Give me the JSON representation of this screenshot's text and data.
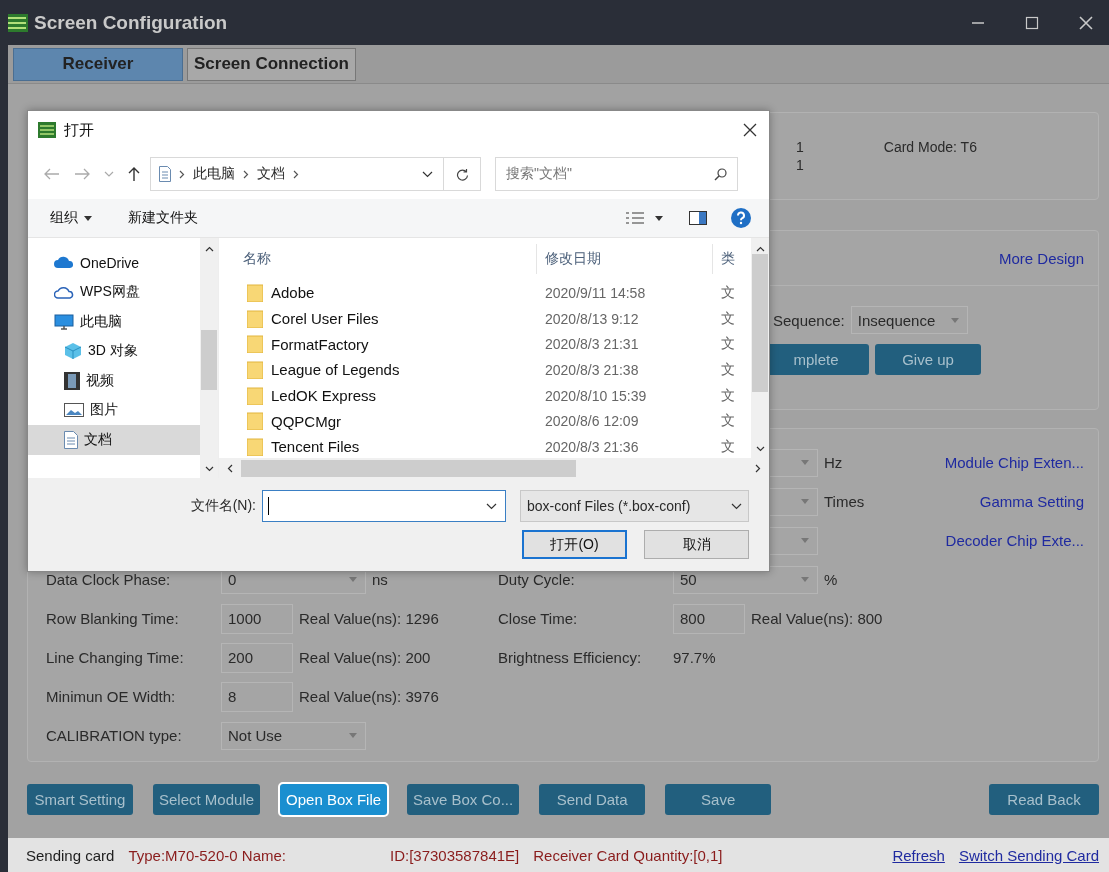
{
  "window": {
    "title": "Screen Configuration"
  },
  "tabs": [
    {
      "label": "Receiver",
      "selected": true
    },
    {
      "label": "Screen Connection",
      "selected": false
    }
  ],
  "card_info": {
    "values": [
      "1",
      "1"
    ],
    "card_mode": "Card Mode:  T6"
  },
  "design": {
    "link": "More Design",
    "sequence_label": "Sequence:",
    "sequence_value": "Insequence",
    "buttons": [
      "mplete",
      "Give up"
    ]
  },
  "parameters": {
    "side_rows": [
      {
        "unit": "Hz",
        "link": "Module Chip Exten..."
      },
      {
        "unit": "Times",
        "link": "Gamma Setting"
      },
      {
        "link": "Decoder Chip Exte..."
      }
    ],
    "rows": [
      {
        "left": {
          "label": "Data Clock Phase:",
          "kind": "dropdown",
          "value": "0",
          "unit": "ns"
        },
        "right": {
          "label": "Duty Cycle:",
          "kind": "dropdown",
          "value": "50",
          "unit": "%"
        }
      },
      {
        "left": {
          "label": "Row Blanking Time:",
          "kind": "input",
          "value": "1000",
          "unit": "Real Value(ns): 1296"
        },
        "right": {
          "label": "Close Time:",
          "kind": "input",
          "value": "800",
          "unit": "Real Value(ns): 800"
        }
      },
      {
        "left": {
          "label": "Line Changing Time:",
          "kind": "input",
          "value": "200",
          "unit": "Real Value(ns): 200"
        },
        "right": {
          "label": "Brightness Efficiency:",
          "kind": "text",
          "value": "97.7%"
        }
      },
      {
        "left": {
          "label": "Minimun OE Width:",
          "kind": "input",
          "value": "8",
          "unit": "Real Value(ns): 3976"
        }
      },
      {
        "left": {
          "label": "CALIBRATION type:",
          "kind": "dropdown",
          "value": "Not Use"
        }
      }
    ]
  },
  "actions": [
    {
      "label": "Smart Setting",
      "focused": false
    },
    {
      "label": "Select Module",
      "focused": false
    },
    {
      "label": "Open Box File",
      "focused": true
    },
    {
      "label": "Save Box Co...",
      "focused": false
    },
    {
      "label": "Send Data",
      "focused": false
    },
    {
      "label": "Save",
      "focused": false
    }
  ],
  "right_action": "Read Back",
  "status_bar": {
    "parts": [
      {
        "text": "Sending card",
        "color": "#1e1e1e"
      },
      {
        "text": "Type:M70-520-0 Name:",
        "color": "#8a1c1c"
      },
      {
        "text": "ID:[37303587841E]",
        "color": "#8a1c1c"
      },
      {
        "text": "Receiver Card Quantity:[0,1]",
        "color": "#8a1c1c"
      }
    ],
    "links": [
      "Refresh",
      "Switch Sending Card"
    ]
  },
  "dialog": {
    "title": "打开",
    "breadcrumb": [
      "此电脑",
      "文档"
    ],
    "search_placeholder": "搜索\"文档\"",
    "toolbar": [
      "组织",
      "新建文件夹"
    ],
    "nav": [
      {
        "label": "OneDrive",
        "kind": "cloud",
        "selected": false
      },
      {
        "label": "WPS网盘",
        "kind": "cloud-outline",
        "selected": false
      },
      {
        "label": "此电脑",
        "kind": "computer",
        "selected": false,
        "children": [
          {
            "label": "3D 对象",
            "kind": "cube",
            "selected": false
          },
          {
            "label": "视频",
            "kind": "video",
            "selected": false
          },
          {
            "label": "图片",
            "kind": "picture",
            "selected": false
          },
          {
            "label": "文档",
            "kind": "document",
            "selected": true
          }
        ]
      }
    ],
    "columns": [
      "名称",
      "修改日期",
      "类"
    ],
    "files": [
      {
        "name": "Adobe",
        "date": "2020/9/11 14:58",
        "type": "文"
      },
      {
        "name": "Corel User Files",
        "date": "2020/8/13 9:12",
        "type": "文"
      },
      {
        "name": "FormatFactory",
        "date": "2020/8/3 21:31",
        "type": "文"
      },
      {
        "name": "League of Legends",
        "date": "2020/8/3 21:38",
        "type": "文"
      },
      {
        "name": "LedOK Express",
        "date": "2020/8/10 15:39",
        "type": "文"
      },
      {
        "name": "QQPCMgr",
        "date": "2020/8/6 12:09",
        "type": "文"
      },
      {
        "name": "Tencent Files",
        "date": "2020/8/3 21:36",
        "type": "文"
      }
    ],
    "filename_label": "文件名(N):",
    "filter": "box-conf Files  (*.box-conf)",
    "buttons": [
      {
        "label": "打开(O)",
        "primary": true
      },
      {
        "label": "取消",
        "primary": false
      }
    ]
  }
}
